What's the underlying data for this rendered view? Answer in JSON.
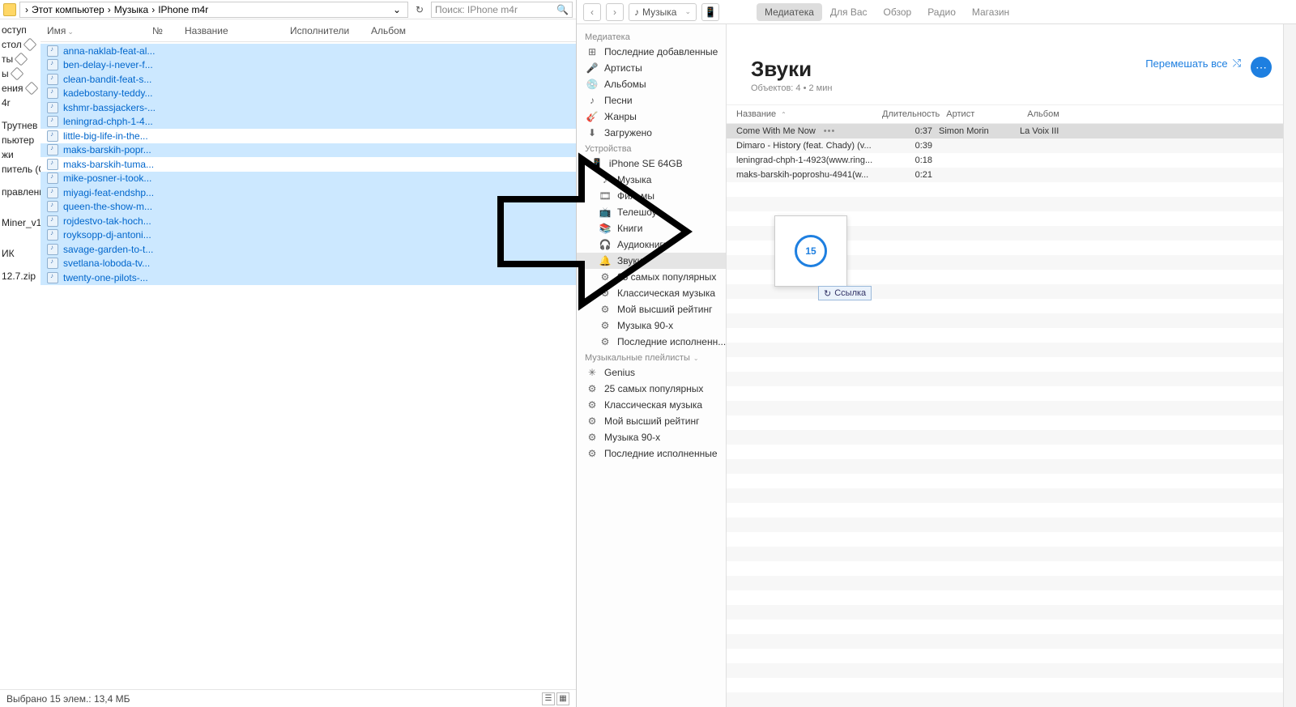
{
  "explorer": {
    "breadcrumb": [
      "Этот компьютер",
      "Музыка",
      "IPhone m4r"
    ],
    "search_placeholder": "Поиск: IPhone m4r",
    "columns": {
      "name": "Имя",
      "no": "№",
      "title": "Название",
      "artist": "Исполнители",
      "album": "Альбом"
    },
    "nav_items": [
      "оступ",
      "стол",
      "ты",
      "ы",
      "ения",
      "4r"
    ],
    "nav_items2": [
      "Трутнев",
      "пьютер",
      "жи",
      "питель (С"
    ],
    "nav_items3": [
      "правлени"
    ],
    "nav_items4": [
      "Miner_v1."
    ],
    "nav_items5": [
      "ИК"
    ],
    "nav_items6": [
      "12.7.zip"
    ],
    "files": [
      {
        "n": "anna-naklab-feat-al...",
        "sel": true
      },
      {
        "n": "ben-delay-i-never-f...",
        "sel": true
      },
      {
        "n": "clean-bandit-feat-s...",
        "sel": true
      },
      {
        "n": "kadebostany-teddy...",
        "sel": true
      },
      {
        "n": "kshmr-bassjackers-...",
        "sel": true
      },
      {
        "n": "leningrad-chph-1-4...",
        "sel": true
      },
      {
        "n": "little-big-life-in-the...",
        "sel": false
      },
      {
        "n": "maks-barskih-popr...",
        "sel": true
      },
      {
        "n": "maks-barskih-tuma...",
        "sel": false
      },
      {
        "n": "mike-posner-i-took...",
        "sel": true
      },
      {
        "n": "miyagi-feat-endshp...",
        "sel": true
      },
      {
        "n": "queen-the-show-m...",
        "sel": true
      },
      {
        "n": "rojdestvo-tak-hoch...",
        "sel": true
      },
      {
        "n": "royksopp-dj-antoni...",
        "sel": true
      },
      {
        "n": "savage-garden-to-t...",
        "sel": true
      },
      {
        "n": "svetlana-loboda-tv...",
        "sel": true
      },
      {
        "n": "twenty-one-pilots-...",
        "sel": true
      }
    ],
    "status": "Выбрано 15 элем.: 13,4 МБ"
  },
  "itunes": {
    "media_label": "Музыка",
    "tabs": [
      "Медиатека",
      "Для Вас",
      "Обзор",
      "Радио",
      "Магазин"
    ],
    "active_tab": 0,
    "sidebar": {
      "section_library": "Медиатека",
      "library_items": [
        "Последние добавленные",
        "Артисты",
        "Альбомы",
        "Песни",
        "Жанры",
        "Загружено"
      ],
      "section_devices": "Устройства",
      "device_root": "iPhone SE 64GB",
      "device_items": [
        "Музыка",
        "Фильмы",
        "Телешоу",
        "Книги",
        "Аудиокниги",
        "Звуки",
        "25 самых популярных",
        "Классическая музыка",
        "Мой высший рейтинг",
        "Музыка 90-х",
        "Последние исполненн..."
      ],
      "device_selected": 5,
      "section_playlists": "Музыкальные плейлисты",
      "playlist_items": [
        "Genius",
        "25 самых популярных",
        "Классическая музыка",
        "Мой высший рейтинг",
        "Музыка 90-х",
        "Последние исполненные"
      ]
    },
    "main": {
      "title": "Звуки",
      "subtitle": "Объектов: 4 • 2 мин",
      "shuffle": "Перемешать все",
      "columns": {
        "name": "Название",
        "duration": "Длительность",
        "artist": "Артист",
        "album": "Альбом"
      },
      "tracks": [
        {
          "name": "Come With Me Now",
          "dur": "0:37",
          "artist": "Simon Morin",
          "album": "La Voix III",
          "sel": true
        },
        {
          "name": "Dimaro - History (feat. Chady) (v...",
          "dur": "0:39",
          "artist": "",
          "album": ""
        },
        {
          "name": "leningrad-chph-1-4923(www.ring...",
          "dur": "0:18",
          "artist": "",
          "album": ""
        },
        {
          "name": "maks-barskih-poproshu-4941(w...",
          "dur": "0:21",
          "artist": "",
          "album": ""
        }
      ],
      "drag_badge": "15",
      "drag_link": "Ссылка"
    }
  }
}
